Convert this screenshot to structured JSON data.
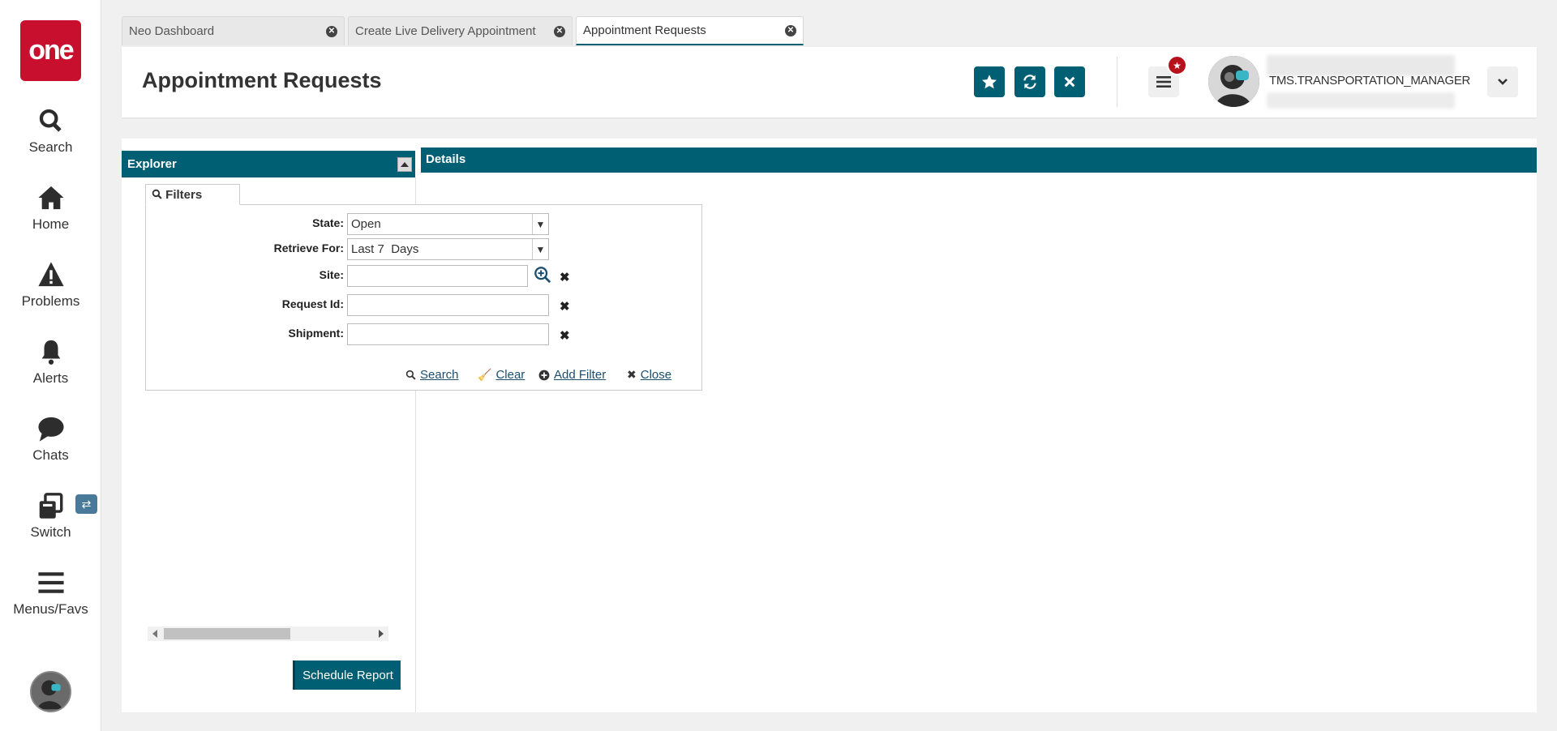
{
  "nav": {
    "logo": "one",
    "items": [
      {
        "label": "Search",
        "icon": "search-icon"
      },
      {
        "label": "Home",
        "icon": "home-icon"
      },
      {
        "label": "Problems",
        "icon": "warning-icon"
      },
      {
        "label": "Alerts",
        "icon": "bell-icon"
      },
      {
        "label": "Chats",
        "icon": "chat-icon"
      },
      {
        "label": "Switch",
        "icon": "switch-icon"
      },
      {
        "label": "Menus/Favs",
        "icon": "hamburger-icon"
      }
    ]
  },
  "tabs": [
    {
      "label": "Neo Dashboard",
      "active": false
    },
    {
      "label": "Create Live Delivery Appointment",
      "active": false
    },
    {
      "label": "Appointment Requests",
      "active": true
    }
  ],
  "header": {
    "title": "Appointment Requests",
    "user_role": "TMS.TRANSPORTATION_MANAGER"
  },
  "explorer": {
    "title": "Explorer",
    "filters_tab": "Filters",
    "fields": {
      "state": {
        "label": "State:",
        "value": "Open"
      },
      "retrieve_for": {
        "label": "Retrieve For:",
        "value": "Last 7  Days"
      },
      "site": {
        "label": "Site:",
        "value": ""
      },
      "request_id": {
        "label": "Request Id:",
        "value": ""
      },
      "shipment": {
        "label": "Shipment:",
        "value": ""
      }
    },
    "actions": {
      "search": "Search",
      "clear": "Clear",
      "add_filter": "Add Filter",
      "close": "Close"
    },
    "schedule_report": "Schedule Report"
  },
  "details": {
    "title": "Details"
  },
  "colors": {
    "brand": "#c8102e",
    "accent": "#005f73",
    "badge": "#b5121b"
  }
}
